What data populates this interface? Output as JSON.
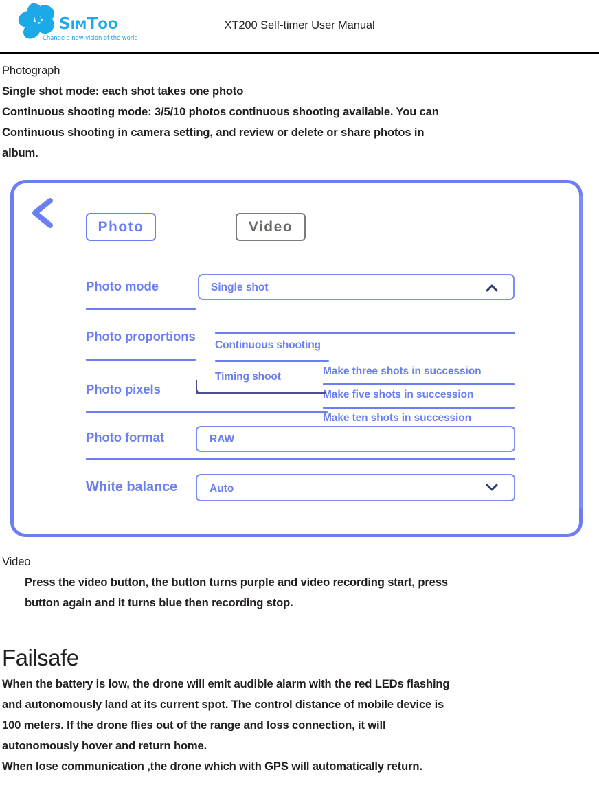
{
  "header": {
    "logo_word_sim": "S",
    "logo_word_im": "IM",
    "logo_word_t": "T",
    "logo_word_oo": "OO",
    "logo_tagline": "Change a new vision of the world",
    "doc_title": "XT200 Self-timer User Manual"
  },
  "body": {
    "section_photograph": "Photograph",
    "lines": [
      "Single shot mode: each shot takes one photo",
      "Continuous shooting mode: 3/5/10 photos continuous shooting available. You can",
      "Continuous shooting in camera setting, and review or delete or share photos in",
      "album."
    ],
    "section_video": "Video",
    "video_lines": [
      "Press the video button, the button turns purple and video recording start, press",
      "button again and it turns blue then recording stop."
    ],
    "section_failsafe": "Failsafe",
    "failsafe_lines": [
      "When the battery is low, the drone will emit audible alarm with the red LEDs flashing",
      "and autonomously land at its current spot. The control distance of mobile device is",
      "100 meters. If the drone flies out of the range and loss connection, it will",
      "autonomously hover and return home.",
      "When lose communication ,the drone which with GPS will automatically return."
    ]
  },
  "app": {
    "back_icon": "chevron-left-icon",
    "tabs": [
      {
        "label": "Photo",
        "active": true
      },
      {
        "label": "Video",
        "active": false
      }
    ],
    "rows": [
      {
        "label": "Photo mode",
        "value": "Single shot",
        "chevron": "chevron-up-icon"
      },
      {
        "label": "Photo proportions",
        "value": "",
        "chevron": ""
      },
      {
        "label": "Photo pixels",
        "value": "",
        "chevron": ""
      },
      {
        "label": "Photo format",
        "value": "RAW",
        "chevron": ""
      },
      {
        "label": "White balance",
        "value": "Auto",
        "chevron": "chevron-down-icon"
      }
    ],
    "photo_mode_options": [
      "Continuous shooting",
      "Timing shoot"
    ],
    "continuous_options": [
      "Make three shots in succession",
      "Make five shots in succession",
      "Make ten shots in succession"
    ]
  },
  "colors": {
    "accent_blue": "#6b7ef2",
    "logo_cyan": "#1BA9E8",
    "inactive_gray": "#7d7a78",
    "chevron_navy": "#2b3a78"
  }
}
